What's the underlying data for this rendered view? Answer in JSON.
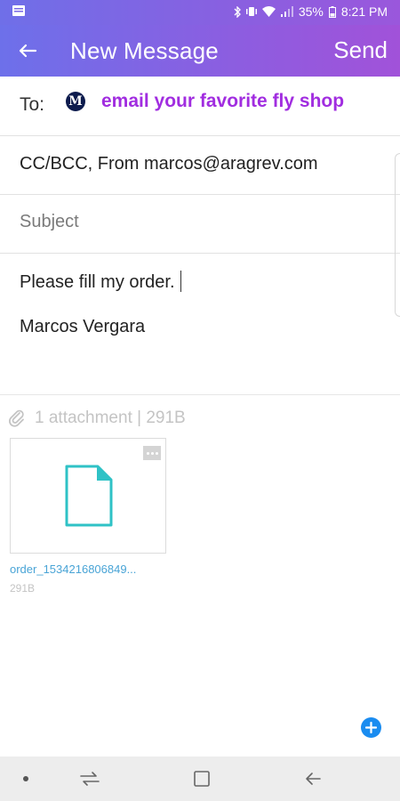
{
  "status_bar": {
    "battery": "35%",
    "time": "8:21 PM"
  },
  "header": {
    "title": "New Message",
    "send_label": "Send"
  },
  "compose": {
    "to_label": "To:",
    "recipient_avatar_letter": "M",
    "recipient": "email your favorite fly shop",
    "cc_from": "CC/BCC, From marcos@aragrev.com",
    "subject_placeholder": "Subject",
    "body_line1": "Please fill my order.",
    "body_line2": "Marcos Vergara"
  },
  "attachments": {
    "summary": "1 attachment | 291B",
    "items": [
      {
        "name": "order_1534216806849...",
        "size": "291B"
      }
    ]
  },
  "colors": {
    "recipient": "#a12de0",
    "accent_blue": "#1a8cf0",
    "file_icon": "#2fc2c6"
  }
}
